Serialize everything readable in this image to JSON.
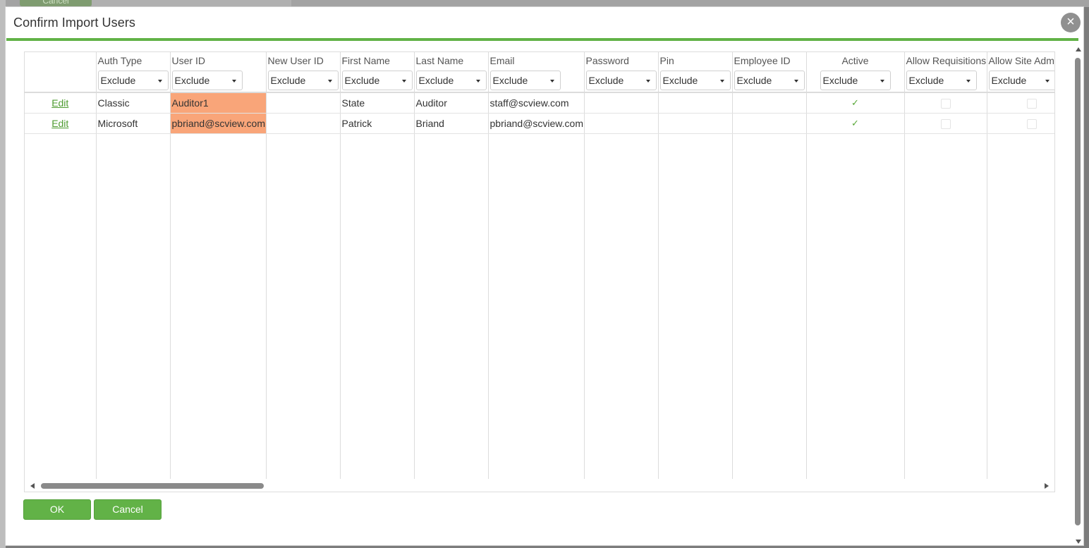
{
  "dialog": {
    "title": "Confirm Import Users",
    "close_label": "×",
    "ok_label": "OK",
    "cancel_label": "Cancel",
    "accent_color": "#62b247",
    "highlight_color": "#f9a579"
  },
  "background": {
    "cancel_label": "Cancel"
  },
  "table": {
    "columns": [
      {
        "label": "",
        "select": ""
      },
      {
        "label": "Auth Type",
        "select": "Exclude"
      },
      {
        "label": "User ID",
        "select": "Exclude"
      },
      {
        "label": "New User ID",
        "select": "Exclude"
      },
      {
        "label": "First Name",
        "select": "Exclude"
      },
      {
        "label": "Last Name",
        "select": "Exclude"
      },
      {
        "label": "Email",
        "select": "Exclude"
      },
      {
        "label": "Password",
        "select": "Exclude"
      },
      {
        "label": "Pin",
        "select": "Exclude"
      },
      {
        "label": "Employee ID",
        "select": "Exclude"
      },
      {
        "label": "Active",
        "select": "Exclude"
      },
      {
        "label": "Allow Requisitions",
        "select": "Exclude"
      },
      {
        "label": "Allow Site Adm",
        "select": "Exclude"
      }
    ],
    "rows": [
      {
        "edit_label": "Edit",
        "auth_type": "Classic",
        "user_id": "Auditor1",
        "new_user_id": "",
        "first_name": "State",
        "last_name": "Auditor",
        "email": "staff@scview.com",
        "password": "",
        "pin": "",
        "employee_id": "",
        "active": true,
        "allow_requisitions": false,
        "allow_site_admin": false
      },
      {
        "edit_label": "Edit",
        "auth_type": "Microsoft",
        "user_id": "pbriand@scview.com",
        "new_user_id": "",
        "first_name": "Patrick",
        "last_name": "Briand",
        "email": "pbriand@scview.com",
        "password": "",
        "pin": "",
        "employee_id": "",
        "active": true,
        "allow_requisitions": false,
        "allow_site_admin": false
      }
    ]
  }
}
